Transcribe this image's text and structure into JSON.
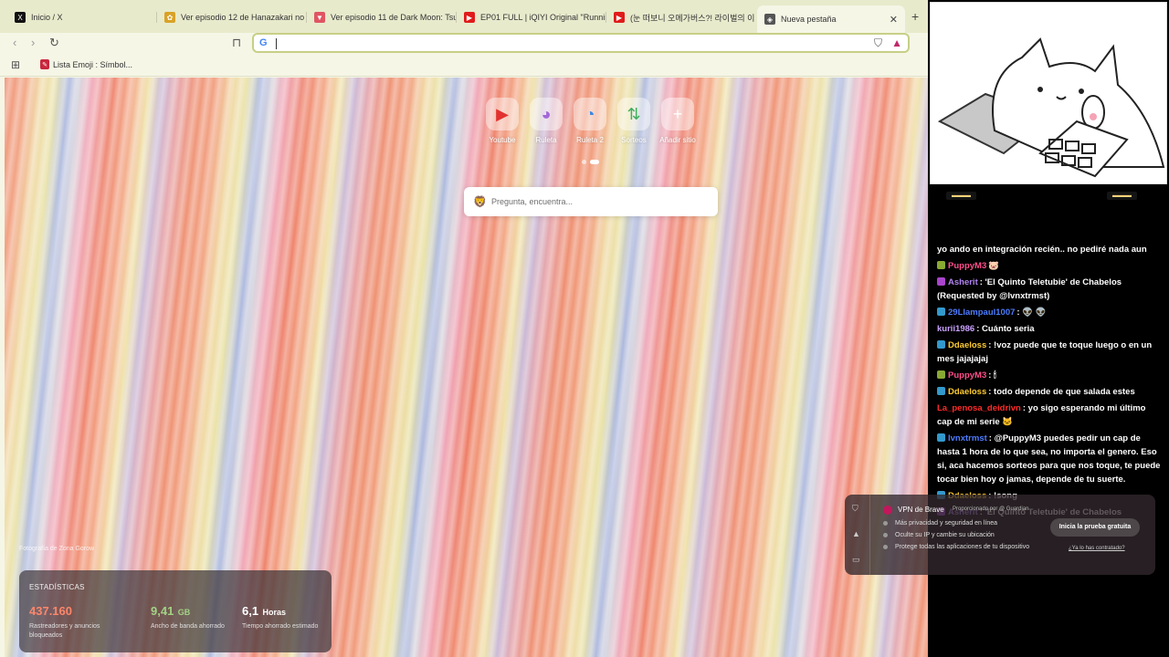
{
  "tabs": [
    {
      "title": "Inicio / X",
      "fav_color": "#111",
      "fav_glyph": "X"
    },
    {
      "title": "Ver episodio 12 de Hanazakari no Ki",
      "fav_color": "#d9a227",
      "fav_glyph": "✿"
    },
    {
      "title": "Ver episodio 11 de Dark Moon: Tsuk",
      "fav_color": "#e05563",
      "fav_glyph": "▼"
    },
    {
      "title": "EP01 FULL | iQIYI Original \"Running",
      "fav_color": "#e01b1b",
      "fav_glyph": "▶"
    },
    {
      "title": "(눈 떠보니 오메가버스?! 라이벌의 이",
      "fav_color": "#e01b1b",
      "fav_glyph": "▶"
    },
    {
      "title": "Nueva pestaña",
      "fav_color": "#555",
      "fav_glyph": "◈"
    }
  ],
  "toolbar": {
    "google_glyph": "G"
  },
  "bookmarks": [
    {
      "label": "Lista Emoji : Símbol..."
    }
  ],
  "tiles": [
    {
      "label": "Youtube",
      "glyph": "▶",
      "color": "#e0201e"
    },
    {
      "label": "Ruleta",
      "glyph": "◕",
      "color": "#9c5bd6"
    },
    {
      "label": "Ruleta 2",
      "glyph": "◔",
      "color": "#2a7be0"
    },
    {
      "label": "Sorteos",
      "glyph": "⇅",
      "color": "#2fa84f"
    },
    {
      "label": "Añadir sitio",
      "glyph": "+",
      "color": "#ffffff"
    }
  ],
  "search": {
    "placeholder": "Pregunta, encuentra..."
  },
  "photo_credit": "Fotografía de Zona Gorow",
  "stats": {
    "title": "ESTADÍSTICAS",
    "items": [
      {
        "num": "437.160",
        "unit": "",
        "desc": "Rastreadores y anuncios bloqueados",
        "color": "#ff7a5c"
      },
      {
        "num": "9,41",
        "unit": "GB",
        "desc": "Ancho de banda ahorrado",
        "color": "#9bcf7a"
      },
      {
        "num": "6,1",
        "unit": "Horas",
        "desc": "Tiempo ahorrado estimado",
        "color": "#ffffff"
      }
    ]
  },
  "vpn": {
    "title": "VPN de Brave",
    "by": "Proporcionado por @ Guardian",
    "features": [
      "Más privacidad y seguridad en línea",
      "Oculte su IP y cambie su ubicación",
      "Protege todas las aplicaciones de tu dispositivo"
    ],
    "cta": "Inicia la prueba gratuita",
    "link": "¿Ya lo has contratado?"
  },
  "chat": [
    {
      "user": "",
      "user_color": "#ff4f8b",
      "text": "yo ando en integración recién.. no pediré nada aun",
      "ico": ""
    },
    {
      "user": "PuppyM3",
      "user_color": "#ff4f8b",
      "text": "🐷",
      "ico": "#8a3"
    },
    {
      "user": "Asherit",
      "user_color": "#b083f0",
      "text": ": 'El Quinto Teletubie' de Chabelos (Requested by @lvnxtrmst)",
      "ico": "#a4c"
    },
    {
      "user": "29Llampaul1007",
      "user_color": "#4d7cff",
      "text": ": 👽 👽",
      "ico": "#39c"
    },
    {
      "user": "kurii1986",
      "user_color": "#c9a0ff",
      "text": ": Cuánto seria",
      "ico": ""
    },
    {
      "user": "Ddaeloss",
      "user_color": "#ffcc33",
      "text": ": !voz puede que te toque luego o en un mes jajajajaj",
      "ico": "#39c"
    },
    {
      "user": "PuppyM3",
      "user_color": "#ff4f8b",
      "text": ": 🕯",
      "ico": "#8a3"
    },
    {
      "user": "Ddaeloss",
      "user_color": "#ffcc33",
      "text": ": todo depende de que salada estes",
      "ico": "#39c"
    },
    {
      "user": "La_penosa_deidrivn",
      "user_color": "#ff2a2a",
      "text": ": yo sigo esperando mi último cap de mi serie 🐱",
      "ico": ""
    },
    {
      "user": "lvnxtrmst",
      "user_color": "#4d7cff",
      "text": ": @PuppyM3 puedes pedir un cap de hasta 1 hora de lo que sea, no importa el genero. Eso si, aca hacemos sorteos para que nos toque, te puede tocar bien hoy o jamas, depende de tu suerte.",
      "ico": "#39c"
    },
    {
      "user": "Ddaeloss",
      "user_color": "#ffcc33",
      "text": ": !song",
      "ico": "#39c"
    },
    {
      "user": "Asherit",
      "user_color": "#b083f0",
      "text": ": 'El Quinto Teletubie' de Chabelos",
      "ico": "#a4c"
    }
  ]
}
